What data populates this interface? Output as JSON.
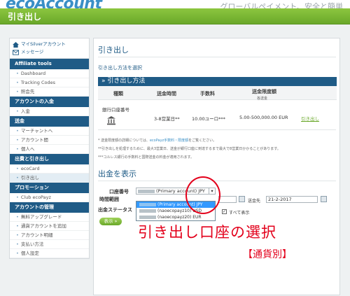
{
  "header": {
    "logo": "ecoAccount",
    "tagline": "グローバルペイメント、安全と簡単",
    "title": "引き出し"
  },
  "sidebar": {
    "top": [
      {
        "label": "マイSilverアカウント",
        "icon": "home-icon"
      },
      {
        "label": "メッセージ",
        "icon": "mail-icon"
      }
    ],
    "sections": [
      {
        "title": "Affiliate tools",
        "items": [
          "Dashboard",
          "Tracking Codes",
          "照会先"
        ]
      },
      {
        "title": "アカウントの入金",
        "items": [
          "入金"
        ]
      },
      {
        "title": "送金",
        "items": [
          "マーチャントへ",
          "アカウント間",
          "個人へ"
        ]
      },
      {
        "title": "出費と引き出し",
        "items": [
          "ecoCard",
          "引き出し"
        ]
      },
      {
        "title": "プロモーション",
        "items": [
          "Club ecoPayz"
        ]
      },
      {
        "title": "アカウントの管理",
        "items": [
          "無料アップグレード",
          "通貨アカウントを追加",
          "アカウント明細",
          "支払い方法",
          "個人設定"
        ]
      }
    ]
  },
  "main": {
    "title": "引き出し",
    "subtitle": "引き出し方法を選択",
    "methods_header": "» 引き出し方法",
    "table": {
      "headers": [
        "種類",
        "送金時間",
        "手数料",
        "送金限度額",
        "各送金"
      ],
      "row": {
        "type": "銀行口座番号",
        "time": "3-8営業日**",
        "fee": "10.00ユーロ***",
        "limit": "5.00-500,000.00 EUR",
        "action": "引き出し"
      }
    },
    "notes": [
      {
        "prefix": "* 送金限度額の詳細については、",
        "link": "ecoPayz手数料・限度額",
        "suffix": "をご覧ください。"
      },
      {
        "prefix": "**引き出しを処理するために、最大3営業日、送金が銀行口座に到達するまで最大で8営業日かかることがあります。",
        "link": "",
        "suffix": ""
      },
      {
        "prefix": "***コルレス銀行の手数料と国際送金の料金が適用されます。",
        "link": "",
        "suffix": ""
      }
    ],
    "display_title": "出金を表示",
    "form": {
      "account_label": "口座番号",
      "account_value": "(Primary account) JPY",
      "period_label": "時間範囲",
      "status_label": "出金ステータス",
      "to_label": "送金先",
      "to_date": "21-2-2017",
      "show_all": "すべて表示",
      "button": "表示 »",
      "options": [
        {
          "label": "(Primary account) JPY",
          "selected": true
        },
        {
          "label": "(naoecopayz10) USD",
          "selected": false
        },
        {
          "label": "(naoecopayz20) EUR",
          "selected": false
        }
      ]
    }
  },
  "annotation": {
    "main": "引き出し口座の選択",
    "sub": "【通貨別】",
    "color": "#e3001b"
  }
}
